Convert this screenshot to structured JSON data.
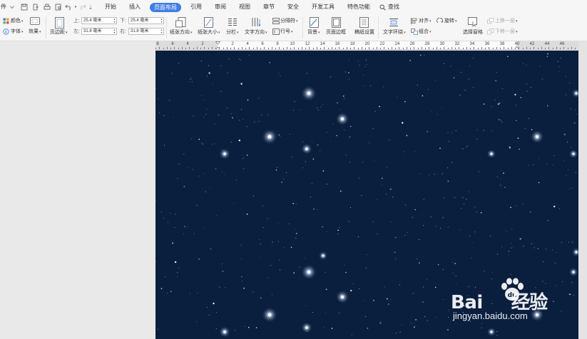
{
  "menubar": {
    "file": "件",
    "tabs": [
      "开始",
      "插入",
      "页面布局",
      "引用",
      "审阅",
      "视图",
      "章节",
      "安全",
      "开发工具",
      "特色功能"
    ],
    "search": "查找"
  },
  "ribbon": {
    "colors": "颜色",
    "fonts": "字体",
    "effects": "效果",
    "margins": "页边距",
    "top_label": "上:",
    "top_value": "25.4 毫米",
    "bottom_label": "下:",
    "bottom_value": "25.4 毫米",
    "left_label": "左:",
    "left_value": "31.8 毫米",
    "right_label": "右:",
    "right_value": "31.8 毫米",
    "orientation": "纸张方向",
    "size": "纸张大小",
    "columns": "分栏",
    "text_direction": "文字方向",
    "breaks": "分隔符",
    "line_numbers": "行号",
    "background": "背景",
    "page_borders": "页面边框",
    "manuscript": "稿纸设置",
    "text_wrap": "文字环绕",
    "align": "对齐",
    "group": "组合",
    "rotate": "旋转",
    "selection_pane": "选择窗格",
    "bring_forward": "上移一层",
    "send_backward": "下移一层"
  },
  "ruler": {
    "labels": [
      "8",
      "6",
      "4",
      "2",
      "2",
      "4",
      "6",
      "8",
      "10",
      "12",
      "14",
      "16",
      "18",
      "20",
      "22",
      "24",
      "26",
      "28",
      "30",
      "32",
      "34",
      "36",
      "38",
      "40",
      "42",
      "44",
      "46"
    ]
  },
  "page": {
    "background_color": "#0a1f3e",
    "image": "starry-night-sky"
  },
  "watermark": {
    "brand_a": "Bai",
    "brand_b": "经验",
    "url": "jingyan.baidu.com"
  },
  "colors": {
    "accent": "#3e7de6",
    "chrome": "#f6f6f6",
    "workspace": "#e9e9e9"
  }
}
